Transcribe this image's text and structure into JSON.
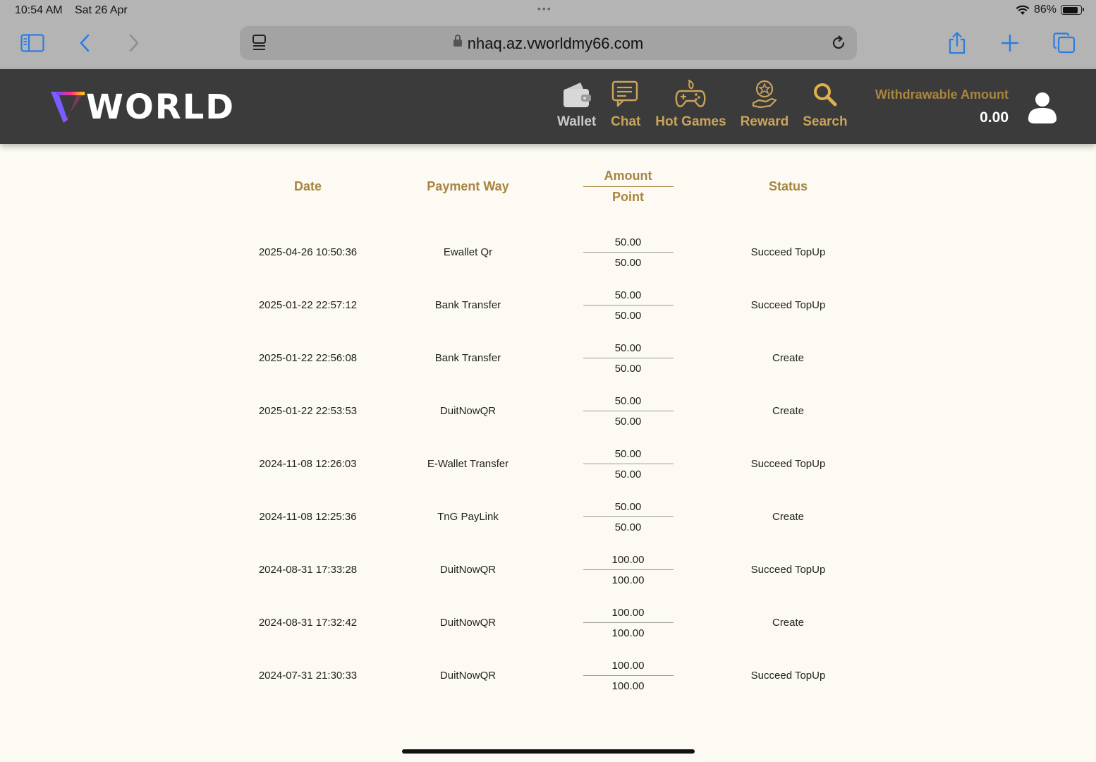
{
  "status_bar": {
    "time": "10:54 AM",
    "date": "Sat 26 Apr",
    "battery": "86%"
  },
  "browser": {
    "url": "nhaq.az.vworldmy66.com"
  },
  "site": {
    "logo_text": "WORLD",
    "nav": [
      {
        "label": "Wallet",
        "icon": "wallet-icon"
      },
      {
        "label": "Chat",
        "icon": "chat-icon"
      },
      {
        "label": "Hot Games",
        "icon": "gamepad-icon"
      },
      {
        "label": "Reward",
        "icon": "reward-icon"
      },
      {
        "label": "Search",
        "icon": "search-icon"
      }
    ],
    "withdrawable_label": "Withdrawable Amount",
    "withdrawable_value": "0.00"
  },
  "colors": {
    "accent": "#a88540",
    "header_bg": "#3b3b3b",
    "page_bg": "#fdfaf3"
  },
  "table": {
    "headers": {
      "date": "Date",
      "payment_way": "Payment Way",
      "amount": "Amount",
      "point": "Point",
      "status": "Status"
    },
    "rows": [
      {
        "date": "2025-04-26 10:50:36",
        "payment_way": "Ewallet Qr",
        "amount": "50.00",
        "point": "50.00",
        "status": "Succeed TopUp"
      },
      {
        "date": "2025-01-22 22:57:12",
        "payment_way": "Bank Transfer",
        "amount": "50.00",
        "point": "50.00",
        "status": "Succeed TopUp"
      },
      {
        "date": "2025-01-22 22:56:08",
        "payment_way": "Bank Transfer",
        "amount": "50.00",
        "point": "50.00",
        "status": "Create"
      },
      {
        "date": "2025-01-22 22:53:53",
        "payment_way": "DuitNowQR",
        "amount": "50.00",
        "point": "50.00",
        "status": "Create"
      },
      {
        "date": "2024-11-08 12:26:03",
        "payment_way": "E-Wallet Transfer",
        "amount": "50.00",
        "point": "50.00",
        "status": "Succeed TopUp"
      },
      {
        "date": "2024-11-08 12:25:36",
        "payment_way": "TnG PayLink",
        "amount": "50.00",
        "point": "50.00",
        "status": "Create"
      },
      {
        "date": "2024-08-31 17:33:28",
        "payment_way": "DuitNowQR",
        "amount": "100.00",
        "point": "100.00",
        "status": "Succeed TopUp"
      },
      {
        "date": "2024-08-31 17:32:42",
        "payment_way": "DuitNowQR",
        "amount": "100.00",
        "point": "100.00",
        "status": "Create"
      },
      {
        "date": "2024-07-31 21:30:33",
        "payment_way": "DuitNowQR",
        "amount": "100.00",
        "point": "100.00",
        "status": "Succeed TopUp"
      }
    ]
  }
}
